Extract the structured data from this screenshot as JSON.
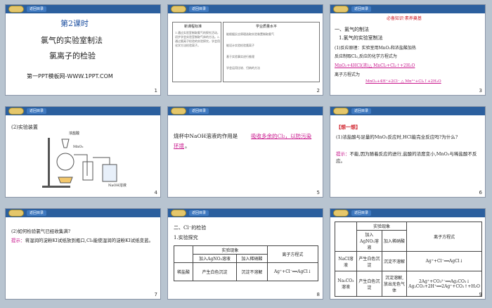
{
  "brand": {
    "button_label": "返回目录"
  },
  "slides": [
    {
      "number": "1",
      "lesson": "第2课时",
      "title1": "氯气的实验室制法",
      "title2": "氯离子的检验",
      "footer": "第一PPT模板网-WWW.1PPT.COM"
    },
    {
      "number": "2",
      "col1_header": "新课程标准",
      "col2_header": "学业质量水平",
      "col1_text": "1.通过实验室制取氯气的探究活动，初步学会实验室制取气体的方法。2.通过氯离子检验的实验探究，学会用化学方法检验离子。",
      "rows": [
        "能根据反应原理选取实验装置制取氯气",
        "能设计实验检验氯离子",
        "基于实验事实进行推理",
        "学会运用比较、归纳的方法"
      ],
      "row_labels": [
        "合格",
        "考试",
        "等级"
      ]
    },
    {
      "number": "3",
      "banner": "必备知识·素养奠基",
      "h1": "一、氯气的制法",
      "h2": "1.氯气的实验室制法",
      "l1": "(1)反应原理：实验室用MnO₂和浓盐酸加热",
      "l2": "反应制取Cl₂,反应的化学方程式为",
      "eq1": "MnO₂+4HCl(浓)△ MnCl₂+Cl₂↑+2H₂O",
      "l3": "离子方程式为",
      "eq2": "MnO₂+4H⁺+2Cl⁻ △ Mn²⁺+Cl₂↑+2H₂O"
    },
    {
      "number": "4",
      "heading": "(2)实验装置",
      "lbl1": "浓盐酸",
      "lbl2": "MnO₂",
      "lbl3": "NaOH溶液"
    },
    {
      "number": "5",
      "pre": "烧杯中NaOH溶液的作用是",
      "ans": "吸收多余的Cl₂，以防污染",
      "ans2": "环境",
      "end": "。"
    },
    {
      "number": "6",
      "title": "【想一想】",
      "q": "(1)浓盐酸与足量的MnO₂反应时,HCl能完全反应吗?为什么?",
      "hint": "提示：",
      "a": "不能,因为随着反应的进行,盐酸的浓度变小,MnO₂与稀盐酸不反应。"
    },
    {
      "number": "7",
      "q": "(2)如何检验氯气已经收集满?",
      "hint": "提示：",
      "a": "将湿润的淀粉KI试纸放到瓶口,Cl₂能使湿润的淀粉KI试纸变蓝。"
    },
    {
      "number": "8",
      "h1": "二、Cl⁻的检验",
      "h2": "1.实验探究",
      "table": {
        "h_phen": "实验现象",
        "h_ag": "加入AgNO₃溶液",
        "h_hno3": "加入稀硝酸",
        "h_eq": "离子方程式",
        "row": "稀盐酸",
        "c1": "产生白色沉淀",
        "c2": "沉淀不溶解",
        "c3": "Ag⁺+Cl⁻══AgCl↓"
      }
    },
    {
      "number": "9",
      "table": {
        "h_phen": "实验现象",
        "h_ag": "加入AgNO₃溶液",
        "h_hno3": "加入稀硝酸",
        "h_eq": "离子方程式",
        "r1": "NaCl溶液",
        "r1c1": "产生白色沉淀",
        "r1c2": "沉淀不溶解",
        "r1c3": "Ag⁺+Cl⁻══AgCl↓",
        "r2": "Na₂CO₃溶液",
        "r2c1": "产生白色沉淀",
        "r2c2": "沉淀溶解,放出无色气体",
        "r2c3a": "2Ag⁺+CO₃²⁻══Ag₂CO₃↓",
        "r2c3b": "Ag₂CO₃+2H⁺══2Ag⁺+CO₂↑+H₂O"
      }
    }
  ]
}
